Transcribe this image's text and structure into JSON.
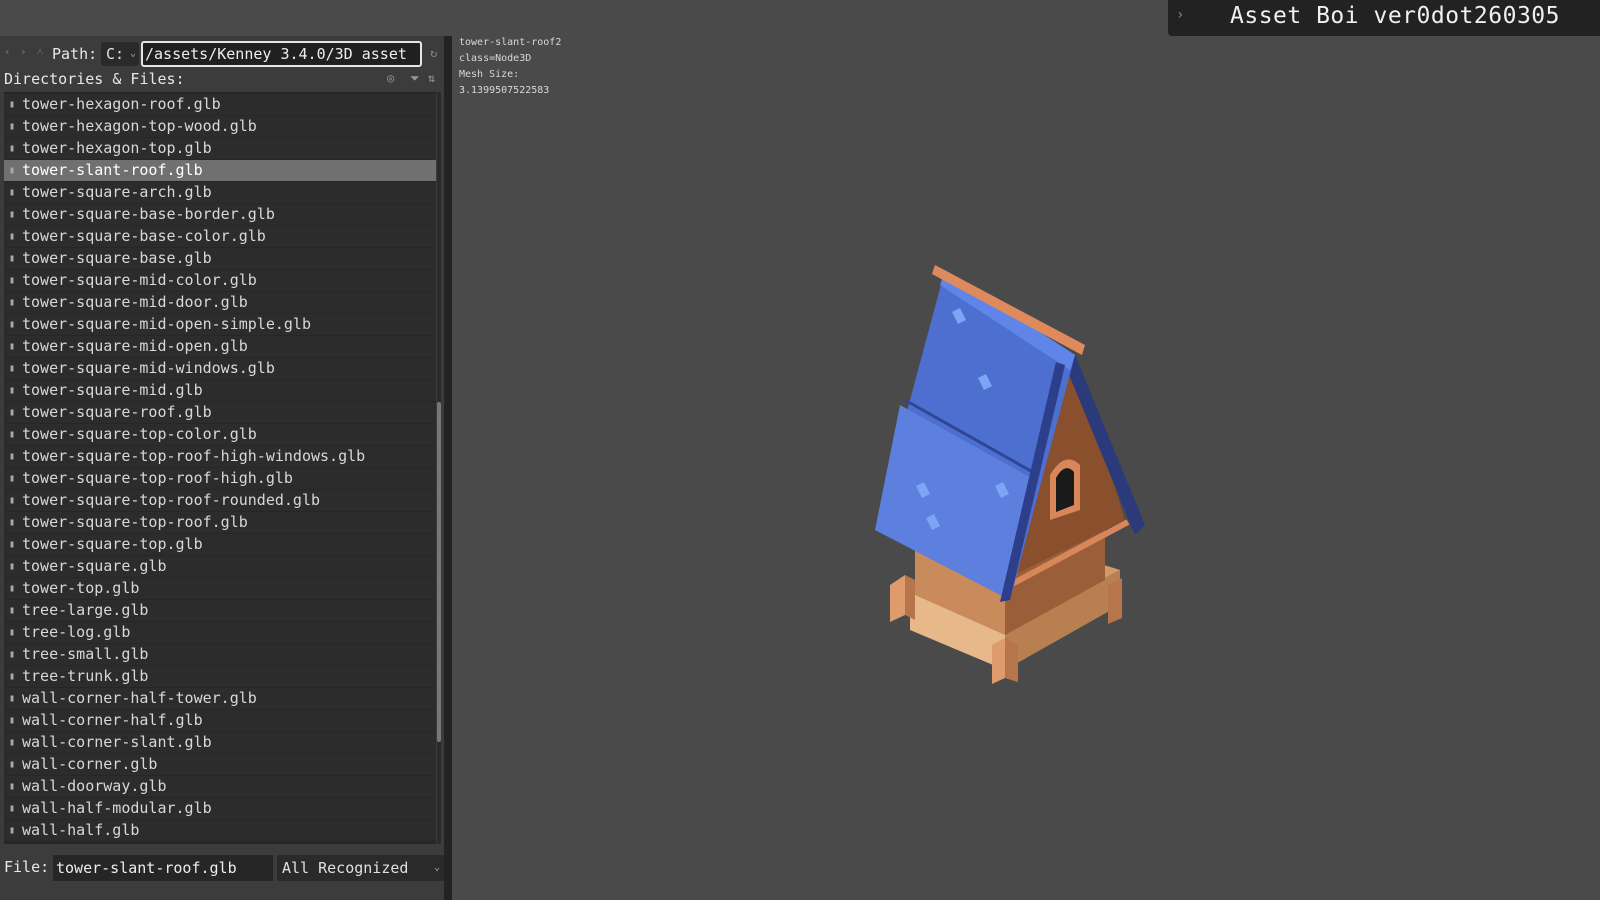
{
  "window": {
    "title": "Asset Boi ver0dot260305",
    "collapse_icon": "chevron-right-icon"
  },
  "info": {
    "node_name": "tower-slant-roof2",
    "class": "class=Node3D",
    "mesh_size_label": "Mesh Size:",
    "mesh_size_value": "3.1399507522583"
  },
  "path_bar": {
    "label": "Path:",
    "drive": "C:",
    "path_value": "/assets/Kenney 3.4.0/3D asset"
  },
  "files_header": {
    "label": "Directories & Files:"
  },
  "file_list": {
    "selected": "tower-slant-roof.glb",
    "items": [
      "tower-hexagon-roof.glb",
      "tower-hexagon-top-wood.glb",
      "tower-hexagon-top.glb",
      "tower-slant-roof.glb",
      "tower-square-arch.glb",
      "tower-square-base-border.glb",
      "tower-square-base-color.glb",
      "tower-square-base.glb",
      "tower-square-mid-color.glb",
      "tower-square-mid-door.glb",
      "tower-square-mid-open-simple.glb",
      "tower-square-mid-open.glb",
      "tower-square-mid-windows.glb",
      "tower-square-mid.glb",
      "tower-square-roof.glb",
      "tower-square-top-color.glb",
      "tower-square-top-roof-high-windows.glb",
      "tower-square-top-roof-high.glb",
      "tower-square-top-roof-rounded.glb",
      "tower-square-top-roof.glb",
      "tower-square-top.glb",
      "tower-square.glb",
      "tower-top.glb",
      "tree-large.glb",
      "tree-log.glb",
      "tree-small.glb",
      "tree-trunk.glb",
      "wall-corner-half-tower.glb",
      "wall-corner-half.glb",
      "wall-corner-slant.glb",
      "wall-corner.glb",
      "wall-doorway.glb",
      "wall-half-modular.glb",
      "wall-half.glb"
    ]
  },
  "file_bar": {
    "label": "File:",
    "value": "tower-slant-roof.glb",
    "filter": "All Recognized"
  }
}
